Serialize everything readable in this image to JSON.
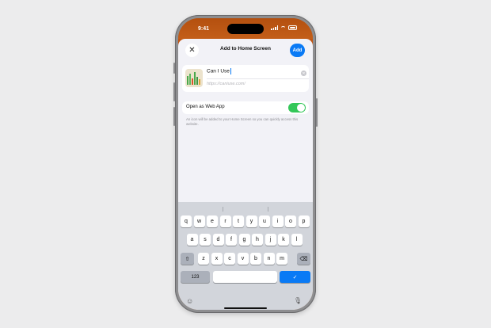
{
  "status_bar": {
    "time": "9:41"
  },
  "sheet": {
    "title": "Add to Home Screen",
    "add_label": "Add",
    "close_icon": "close-icon"
  },
  "app": {
    "name": "Can I Use",
    "url": "https://caniuse.com/",
    "icon": "caniuse-app-icon"
  },
  "web_app": {
    "label": "Open as Web App",
    "enabled": true,
    "note": "An icon will be added to your Home Screen so you can quickly access this website."
  },
  "keyboard": {
    "row1": [
      "q",
      "w",
      "e",
      "r",
      "t",
      "y",
      "u",
      "i",
      "o",
      "p"
    ],
    "row2": [
      "a",
      "s",
      "d",
      "f",
      "g",
      "h",
      "j",
      "k",
      "l"
    ],
    "row3": [
      "z",
      "x",
      "c",
      "v",
      "b",
      "n",
      "m"
    ],
    "numbers_label": "123",
    "done_glyph": "✓",
    "shift_glyph": "⇧",
    "delete_glyph": "⌫",
    "emoji_glyph": "☺",
    "mic_glyph": "🎙"
  }
}
